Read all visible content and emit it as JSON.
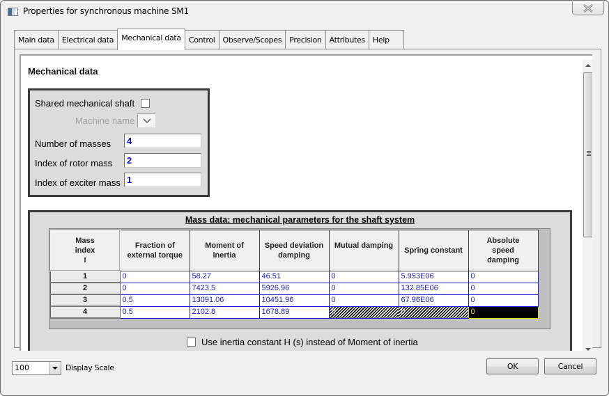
{
  "window": {
    "title": "Properties for synchronous machine SM1",
    "close_label": "Close"
  },
  "tabs": [
    {
      "label": "Main data",
      "active": false
    },
    {
      "label": "Electrical data",
      "active": false
    },
    {
      "label": "Mechanical data",
      "active": true
    },
    {
      "label": "Control",
      "active": false
    },
    {
      "label": "Observe/Scopes",
      "active": false
    },
    {
      "label": "Precision",
      "active": false
    },
    {
      "label": "Attributes",
      "active": false
    },
    {
      "label": "Help",
      "active": false
    }
  ],
  "mechanical": {
    "section_title": "Mechanical data",
    "shared_shaft_label": "Shared mechanical shaft",
    "shared_shaft_checked": false,
    "machine_name_label": "Machine name",
    "number_of_masses_label": "Number of masses",
    "number_of_masses": "4",
    "rotor_mass_label": "Index of rotor mass",
    "rotor_mass": "2",
    "exciter_mass_label": "Index of exciter mass",
    "exciter_mass": "1"
  },
  "mass_data": {
    "title": "Mass data: mechanical parameters for the shaft system",
    "columns": [
      "Mass\nindex\ni",
      "Fraction of\nexternal torque",
      "Moment of\ninertia",
      "Speed deviation\ndamping",
      "Mutual damping",
      "Spring constant",
      "Absolute\nspeed\ndamping"
    ],
    "rows": [
      {
        "index": "1",
        "fraction": "0",
        "inertia": "58.27",
        "speed_damping": "46.51",
        "mutual_damping": "0",
        "spring": "5.953E06",
        "abs_damping": "0"
      },
      {
        "index": "2",
        "fraction": "0",
        "inertia": "7423.5",
        "speed_damping": "5926.96",
        "mutual_damping": "0",
        "spring": "132.85E06",
        "abs_damping": "0"
      },
      {
        "index": "3",
        "fraction": "0.5",
        "inertia": "13091.06",
        "speed_damping": "10451.96",
        "mutual_damping": "0",
        "spring": "67.96E06",
        "abs_damping": "0"
      },
      {
        "index": "4",
        "fraction": "0.5",
        "inertia": "2102.8",
        "speed_damping": "1678.89",
        "mutual_damping": "0",
        "spring": "0",
        "abs_damping": "0"
      }
    ],
    "use_inertia_constant_label": "Use inertia constant H (s) instead of Moment of inertia",
    "use_inertia_constant_checked": false
  },
  "footer": {
    "display_scale_value": "100",
    "display_scale_label": "Display Scale",
    "ok_label": "OK",
    "cancel_label": "Cancel"
  }
}
